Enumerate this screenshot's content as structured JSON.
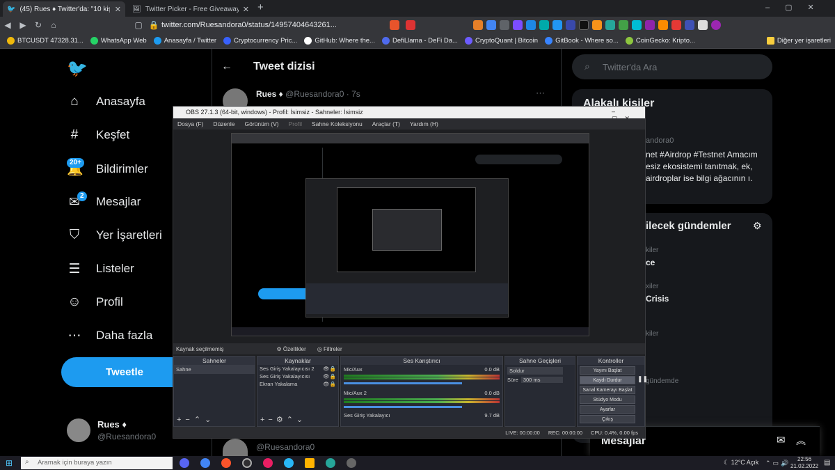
{
  "browser": {
    "tabs": [
      {
        "title": "(45) Rues ♦ Twitter'da: \"10 kişiye",
        "active": true
      },
      {
        "title": "Twitter Picker - Free Giveaway Picker",
        "active": false
      }
    ],
    "new_tab": "+",
    "url": "twitter.com/Ruesandora0/status/14957404643261...",
    "bookmarks": [
      "BTCUSDT 47328.31...",
      "WhatsApp Web",
      "Anasayfa / Twitter",
      "Cryptocurrency Pric...",
      "GitHub: Where the...",
      "DefiLlama - DeFi Da...",
      "CryptoQuant | Bitcoin",
      "GitBook - Where so...",
      "CoinGecko: Kripto..."
    ],
    "other_bookmarks": "Diğer yer işaretleri"
  },
  "twitter": {
    "nav": [
      {
        "label": "Anasayfa",
        "icon": "home-icon"
      },
      {
        "label": "Keşfet",
        "icon": "hashtag-icon"
      },
      {
        "label": "Bildirimler",
        "icon": "bell-icon",
        "badge": "20+"
      },
      {
        "label": "Mesajlar",
        "icon": "mail-icon",
        "badge": "2"
      },
      {
        "label": "Yer İşaretleri",
        "icon": "bookmark-icon"
      },
      {
        "label": "Listeler",
        "icon": "list-icon"
      },
      {
        "label": "Profil",
        "icon": "person-icon"
      },
      {
        "label": "Daha fazla",
        "icon": "more-icon"
      }
    ],
    "tweet_button": "Tweetle",
    "profile": {
      "name": "Rues ♦",
      "handle": "@Ruesandora0"
    },
    "header_title": "Tweet dizisi",
    "tweet_author": {
      "name": "Rues ♦",
      "handle": "@Ruesandora0",
      "time": "· 7s"
    },
    "search_placeholder": "Twitter'da Ara",
    "related_title": "Alakalı kişiler",
    "related_handle": "andora0",
    "related_text": "net #Airdrop #Testnet Amacım esiz ekosistemi tanıtmak, ek, airdroplar ise bilgi ağacının ı.",
    "trends_title": "ilecek gündemler",
    "trends": [
      {
        "meta": "kiler",
        "title": "ce"
      },
      {
        "meta": "xiler",
        "title": "Crisis"
      },
      {
        "meta": "kiler",
        "title": ""
      },
      {
        "meta": "gündemde",
        "title": ""
      }
    ],
    "reply_handle": "@Ruesandora0",
    "messages_label": "Mesajlar"
  },
  "obs": {
    "title": "OBS 27.1.3 (64-bit, windows) - Profil: İsimsiz - Sahneler: İsimsiz",
    "menu": [
      "Dosya (F)",
      "Düzenle",
      "Görünüm (V)",
      "Profil",
      "Sahne Koleksiyonu",
      "Araçlar (T)",
      "Yardım (H)"
    ],
    "source_bar": {
      "label": "Kaynak seçilmemiş",
      "props": "Özellikler",
      "filters": "Filtreler"
    },
    "docks": {
      "scenes": "Sahneler",
      "sources": "Kaynaklar",
      "mixer": "Ses Karıştırıcı",
      "transitions": "Sahne Geçişleri",
      "controls": "Kontroller"
    },
    "scene_item": "Sahne",
    "sources": [
      "Ses Giriş Yakalayıcısı 2",
      "Ses Giriş Yakalayıcısı",
      "Ekran Yakalama"
    ],
    "mixer": [
      {
        "name": "Mic/Aux",
        "db": "0.0 dB"
      },
      {
        "name": "Mic/Aux 2",
        "db": "0.0 dB"
      },
      {
        "name": "Ses Giriş Yakalayıcı",
        "db": "9.7 dB"
      }
    ],
    "transition": {
      "type": "Soldur",
      "duration_label": "Süre",
      "duration": "300 ms"
    },
    "controls": [
      "Yayını Başlat",
      "Kaydı Durdur",
      "Sanal Kamerayı Başlat",
      "Stüdyo Modu",
      "Ayarlar",
      "Çıkış"
    ],
    "status": {
      "live": "LIVE: 00:00:00",
      "rec": "REC: 00:00:00",
      "cpu": "CPU: 0.4%, 0.00 fps"
    }
  },
  "taskbar": {
    "search": "Aramak için buraya yazın",
    "weather": "12°C Açık",
    "time": "22:56",
    "date": "21.02.2022"
  }
}
